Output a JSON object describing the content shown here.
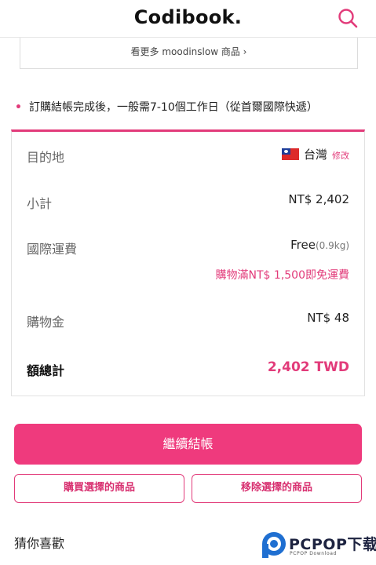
{
  "header": {
    "logo": "Codibook.",
    "search_icon": "search-icon"
  },
  "more_link": {
    "label": "看更多 moodinslow 商品 ›"
  },
  "notice": {
    "bullet": "•",
    "text": "訂購結帳完成後，一般需7-10個工作日（從首爾國際快遞）"
  },
  "summary": {
    "destination": {
      "label": "目的地",
      "country": "台灣",
      "edit": "修改",
      "flag_icon": "taiwan-flag-icon"
    },
    "subtotal": {
      "label": "小計",
      "value": "NT$ 2,402"
    },
    "shipping": {
      "label": "國際運費",
      "value": "Free",
      "weight": "(0.9kg)",
      "note": "購物滿NT$ 1,500即免運費"
    },
    "credit": {
      "label": "購物金",
      "value": "NT$ 48"
    },
    "total": {
      "label": "額總計",
      "value": "2,402 TWD"
    }
  },
  "buttons": {
    "checkout": "繼續結帳",
    "buy_selected": "購買選擇的商品",
    "remove_selected": "移除選擇的商品"
  },
  "recommend": {
    "title": "猜你喜歡"
  },
  "watermark": {
    "name": "PCPOP下载",
    "sub": "PCPOP Download"
  },
  "colors": {
    "accent": "#ef3a7d",
    "accent_text": "#e23b7a"
  }
}
